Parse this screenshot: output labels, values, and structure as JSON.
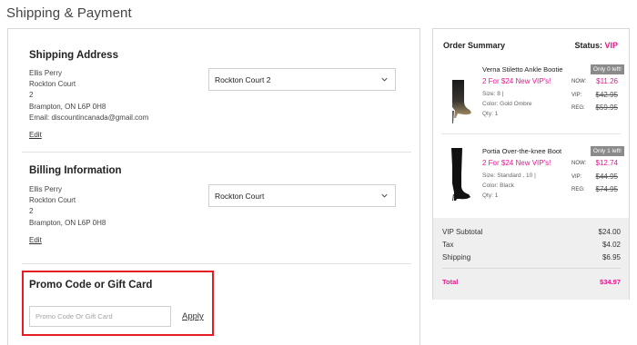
{
  "page": {
    "title": "Shipping & Payment"
  },
  "shipping": {
    "heading": "Shipping Address",
    "name": "Ellis Perry",
    "street": "Rockton Court",
    "unit": "2",
    "city": "Brampton, ON L6P 0H8",
    "email": "Email: discountincanada@gmail.com",
    "edit_label": "Edit",
    "select_value": "Rockton Court 2"
  },
  "billing": {
    "heading": "Billing Information",
    "name": "Ellis Perry",
    "street": "Rockton Court",
    "unit": "2",
    "city": "Brampton, ON L6P 0H8",
    "edit_label": "Edit",
    "select_value": "Rockton Court"
  },
  "promo": {
    "heading": "Promo Code or Gift Card",
    "placeholder": "Promo Code Or Gift Card",
    "apply_label": "Apply"
  },
  "summary": {
    "title": "Order Summary",
    "status_label": "Status:",
    "status_value": "VIP",
    "items": [
      {
        "name": "Verna Stiletto Ankle Bootie",
        "badge": "Only 0 left!",
        "promo": "2 For $24 New VIP's!",
        "size": "Size: 8  |",
        "color": "Color: Gold Ombre",
        "qty": "Qty: 1",
        "now_label": "NOW:",
        "now_price": "$11.26",
        "vip_label": "VIP:",
        "vip_price": "$42.95",
        "reg_label": "REG:",
        "reg_price": "$59.95"
      },
      {
        "name": "Portia Over-the-knee Boot",
        "badge": "Only 1 left!",
        "promo": "2 For $24 New VIP's!",
        "size": "Size: Standard , 10  |",
        "color": "Color: Black",
        "qty": "Qty: 1",
        "now_label": "NOW:",
        "now_price": "$12.74",
        "vip_label": "VIP:",
        "vip_price": "$44.95",
        "reg_label": "REG:",
        "reg_price": "$74.95"
      }
    ],
    "totals": {
      "subtotal_label": "VIP Subtotal",
      "subtotal": "$24.00",
      "tax_label": "Tax",
      "tax": "$4.02",
      "shipping_label": "Shipping",
      "shipping": "$6.95",
      "total_label": "Total",
      "total": "$34.97"
    }
  },
  "colors": {
    "accent": "#e21a8e",
    "highlight": "#e51c23",
    "badge": "#8a8a8a"
  },
  "icons": {
    "select_chevron": "chevron-down-icon"
  }
}
